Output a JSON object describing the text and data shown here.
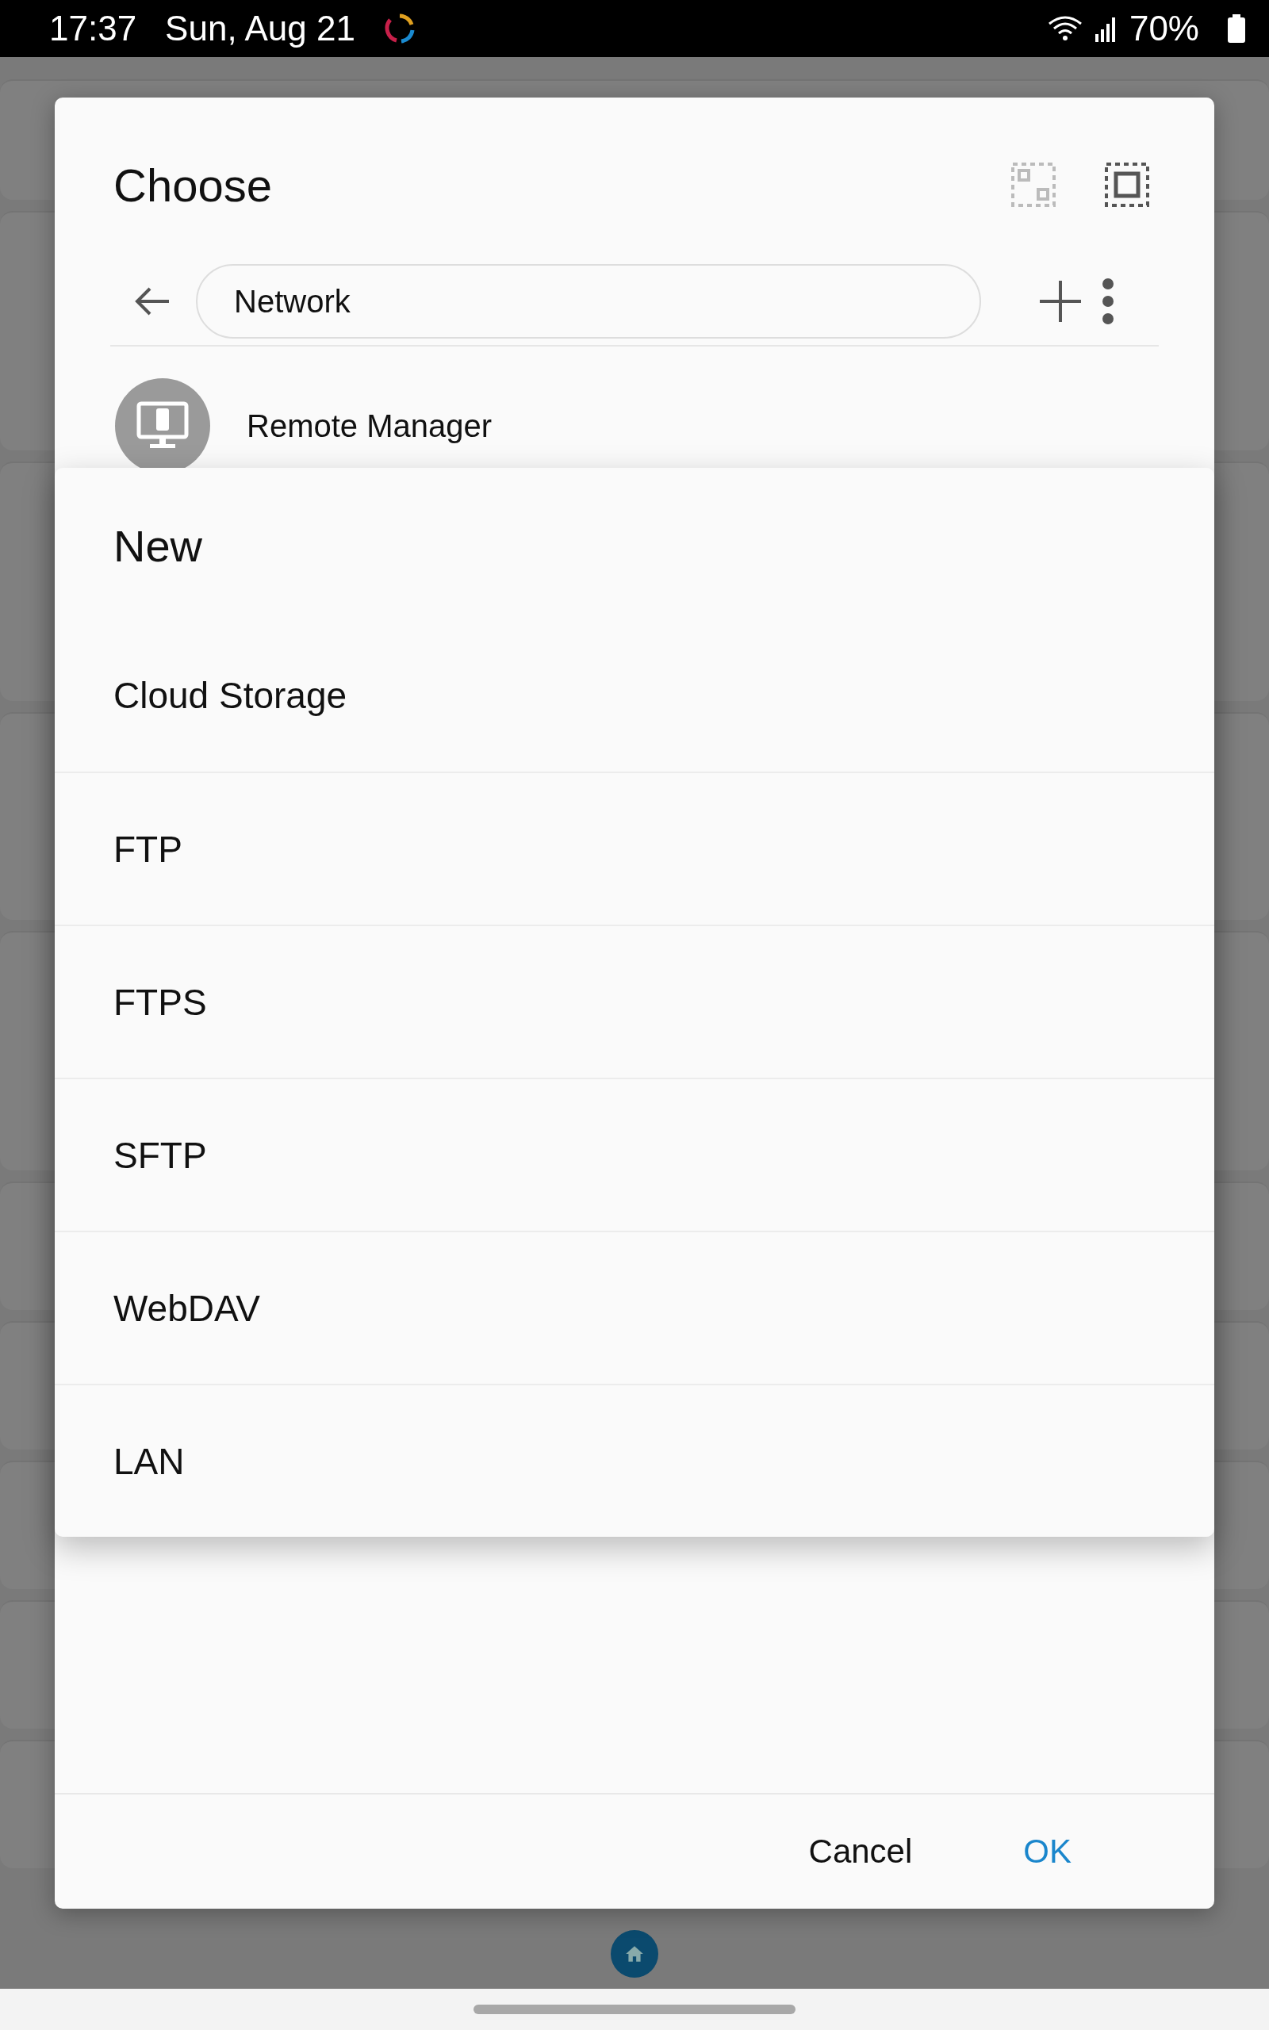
{
  "status_bar": {
    "time": "17:37",
    "date": "Sun, Aug 21",
    "battery": "70%"
  },
  "dialog": {
    "title": "Choose",
    "path_field": {
      "value": "Network"
    },
    "items": [
      {
        "label": "Remote Manager"
      }
    ],
    "buttons": [
      {
        "label": "Cancel",
        "kind": "secondary"
      },
      {
        "label": "OK",
        "kind": "primary"
      }
    ]
  },
  "menu": {
    "title": "New",
    "items": [
      {
        "label": "Cloud Storage"
      },
      {
        "label": "FTP"
      },
      {
        "label": "FTPS"
      },
      {
        "label": "SFTP"
      },
      {
        "label": "WebDAV"
      },
      {
        "label": "LAN"
      }
    ]
  }
}
